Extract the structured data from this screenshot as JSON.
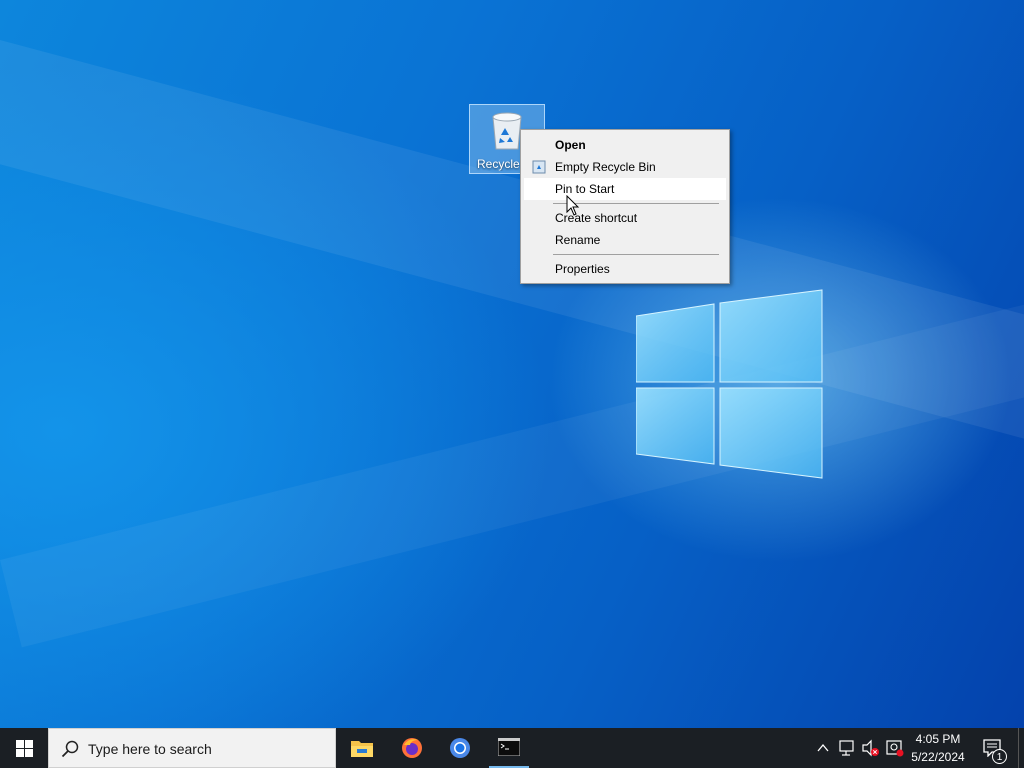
{
  "desktop": {
    "icons": [
      {
        "label": "Recycle Bin",
        "icon": "recycle-bin-icon"
      }
    ]
  },
  "context_menu": {
    "items": [
      {
        "label": "Open",
        "bold": true
      },
      {
        "label": "Empty Recycle Bin",
        "icon": "recycle-bin-small-icon"
      },
      {
        "label": "Pin to Start",
        "highlighted": true
      },
      {
        "label": "Create shortcut"
      },
      {
        "label": "Rename"
      },
      {
        "label": "Properties"
      }
    ]
  },
  "taskbar": {
    "search_placeholder": "Type here to search",
    "apps": [
      "file-explorer-icon",
      "firefox-icon",
      "chrome-icon",
      "terminal-icon"
    ],
    "active_app": "terminal-icon",
    "tray_icons": [
      "chevron-up-icon",
      "network-icon",
      "volume-muted-icon",
      "battery-icon"
    ],
    "clock": {
      "time": "4:05 PM",
      "date": "5/22/2024"
    },
    "notification_count": "1"
  },
  "colors": {
    "desktop_blue": "#0a73d4",
    "taskbar": "#1b1f24",
    "menu_bg": "#f0f0f0",
    "menu_highlight": "#ffffff"
  }
}
